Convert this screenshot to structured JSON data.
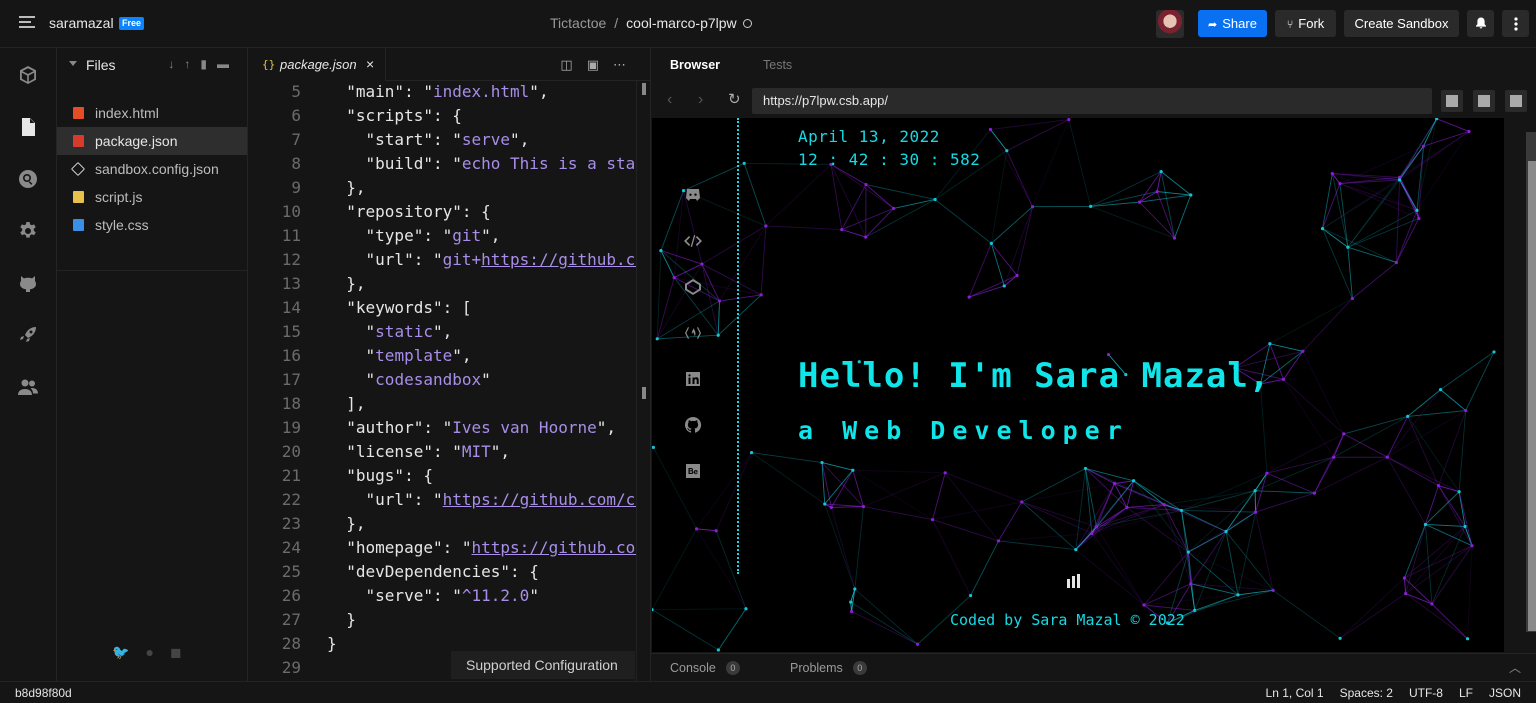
{
  "header": {
    "user_name": "saramazal",
    "plan_badge": "Free",
    "project": "Tictactoe",
    "separator": "/",
    "sandbox_name": "cool-marco-p7lpw",
    "share_label": "Share",
    "fork_label": "Fork",
    "create_label": "Create Sandbox"
  },
  "explorer": {
    "title": "Files",
    "files": [
      {
        "name": "index.html",
        "icon_color": "#e44d26"
      },
      {
        "name": "package.json",
        "icon_color": "#d83b2c"
      },
      {
        "name": "sandbox.config.json",
        "icon_color": "#cccccc"
      },
      {
        "name": "script.js",
        "icon_color": "#e7c14c"
      },
      {
        "name": "style.css",
        "icon_color": "#3a8ee6"
      }
    ]
  },
  "editor": {
    "tab_icon": "{}",
    "tab_name": "package.json",
    "tab_close": "×",
    "tooltip": "Supported Configuration",
    "lines": [
      {
        "n": "5",
        "text": "  \"main\": \"index.html\","
      },
      {
        "n": "6",
        "text": "  \"scripts\": {"
      },
      {
        "n": "7",
        "text": "    \"start\": \"serve\","
      },
      {
        "n": "8",
        "text": "    \"build\": \"echo This is a stati"
      },
      {
        "n": "9",
        "text": "  },"
      },
      {
        "n": "10",
        "text": "  \"repository\": {"
      },
      {
        "n": "11",
        "text": "    \"type\": \"git\","
      },
      {
        "n": "12",
        "text": "    \"url\": \"git+https://github.com"
      },
      {
        "n": "13",
        "text": "  },"
      },
      {
        "n": "14",
        "text": "  \"keywords\": ["
      },
      {
        "n": "15",
        "text": "    \"static\","
      },
      {
        "n": "16",
        "text": "    \"template\","
      },
      {
        "n": "17",
        "text": "    \"codesandbox\""
      },
      {
        "n": "18",
        "text": "  ],"
      },
      {
        "n": "19",
        "text": "  \"author\": \"Ives van Hoorne\","
      },
      {
        "n": "20",
        "text": "  \"license\": \"MIT\","
      },
      {
        "n": "21",
        "text": "  \"bugs\": {"
      },
      {
        "n": "22",
        "text": "    \"url\": \"https://github.com/cod"
      },
      {
        "n": "23",
        "text": "  },"
      },
      {
        "n": "24",
        "text": "  \"homepage\": \"https://github.com/"
      },
      {
        "n": "25",
        "text": "  \"devDependencies\": {"
      },
      {
        "n": "26",
        "text": "    \"serve\": \"^11.2.0\""
      },
      {
        "n": "27",
        "text": "  }"
      },
      {
        "n": "28",
        "text": "}"
      },
      {
        "n": "29",
        "text": ""
      }
    ]
  },
  "preview": {
    "tab_browser": "Browser",
    "tab_tests": "Tests",
    "url": "https://p7lpw.csb.app/",
    "site": {
      "date": "April 13, 2022",
      "time": "12 : 42 : 30 : 582",
      "hello": "Hello! I'm Sara Mazal,",
      "role": "a Web Developer",
      "footer": "Coded by Sara Mazal © 2022"
    },
    "console_label": "Console",
    "console_count": "0",
    "problems_label": "Problems",
    "problems_count": "0"
  },
  "status": {
    "commit": "b8d98f80d",
    "cursor": "Ln 1, Col 1",
    "spaces": "Spaces: 2",
    "encoding": "UTF-8",
    "eol": "LF",
    "language": "JSON"
  },
  "colors": {
    "accent": "#0971f1",
    "neon_cyan": "#10e6e9",
    "neon_purple": "#8a1fd6",
    "string_purple": "#a88ee8"
  }
}
